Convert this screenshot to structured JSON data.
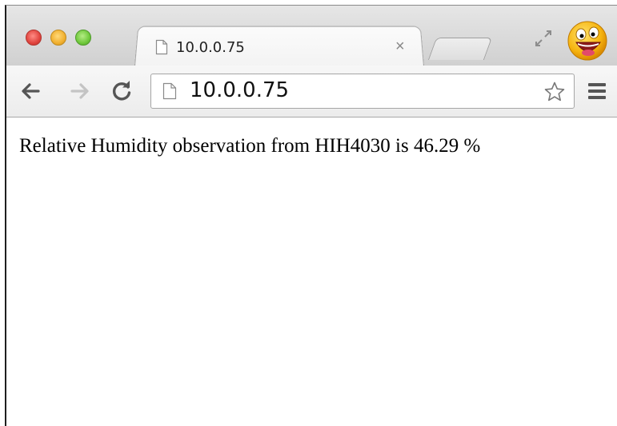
{
  "browser": {
    "tab": {
      "title": "10.0.0.75",
      "close_glyph": "×",
      "favicon": "page-icon"
    },
    "toolbar": {
      "back_icon": "back-arrow-icon",
      "forward_icon": "forward-arrow-icon",
      "reload_icon": "reload-icon",
      "address": "10.0.0.75",
      "bookmark_icon": "star-icon",
      "menu_icon": "hamburger-menu-icon"
    },
    "window_controls": {
      "close_color": "#e0443e",
      "minimize_color": "#f1b02f",
      "zoom_color": "#6fc83b"
    },
    "profile_avatar": "smiley-face-icon"
  },
  "page": {
    "body_text": "Relative Humidity observation from HIH4030 is 46.29 %"
  }
}
